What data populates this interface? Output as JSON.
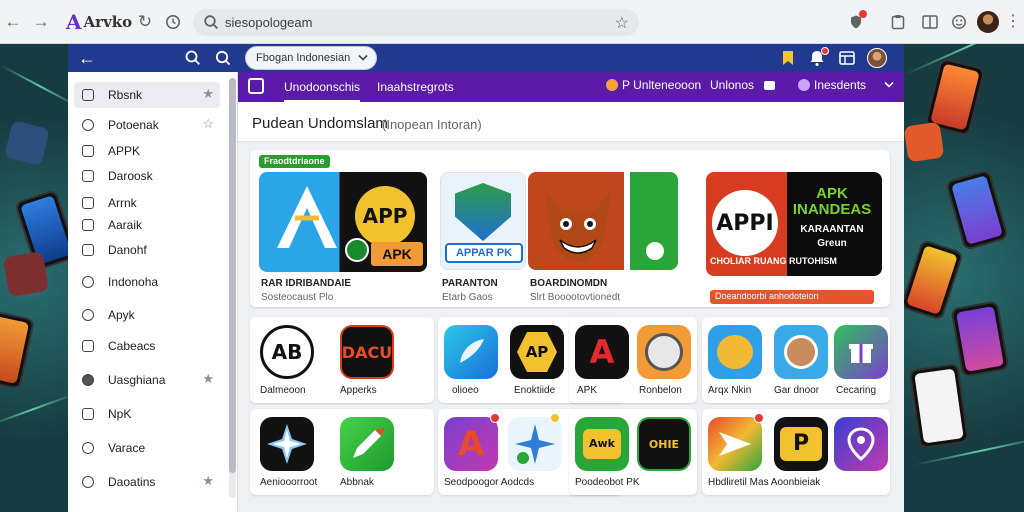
{
  "browser": {
    "brand_mark": "A",
    "brand_text": "Arvko",
    "url": "siesopologeam",
    "nav_back": "←",
    "nav_forward": "→",
    "reload": "↻",
    "menu": "⋮"
  },
  "app": {
    "country_selector": "Fbogan Indonesian",
    "tabs": [
      {
        "label": "Unodoonschis",
        "active": true
      },
      {
        "label": "Inaahstregrots",
        "active": false
      }
    ],
    "tabs_right": [
      {
        "label": "P Unlteneooon",
        "color": "#f2a33a"
      },
      {
        "label": "Unlonos",
        "color": "#ffffff"
      },
      {
        "label": "Inesdents",
        "color": "#c9a3ff"
      }
    ]
  },
  "sidebar": {
    "items": [
      {
        "label": "Rbsnk",
        "star": true,
        "active": true
      },
      {
        "label": "Potoenak",
        "star": true
      },
      {
        "label": "APPK",
        "star": false
      },
      {
        "label": "Daroosk",
        "star": false
      },
      {
        "label": "Arrnk",
        "star": false
      },
      {
        "label": "Aaraik",
        "star": false
      },
      {
        "label": "Danohf",
        "star": false
      },
      {
        "label": "Indonoha",
        "star": false
      },
      {
        "label": "Apyk",
        "star": false
      },
      {
        "label": "Cabeacs",
        "star": false
      },
      {
        "label": "Uasghiana",
        "star": true
      },
      {
        "label": "NpK",
        "star": false
      },
      {
        "label": "Varace",
        "star": false
      },
      {
        "label": "Daoatins",
        "star": true
      }
    ]
  },
  "main": {
    "title": "Pudean Undomslam",
    "subtitle": "(Inopean Intoran)",
    "featured_badge": "Fraodtdriaone",
    "featured": [
      {
        "title": "RAR IDRIBANDAIE",
        "sub": "Sosteocaust Plo",
        "art_text": "APP",
        "art_tag": "APK"
      },
      {
        "title": "PARANTON",
        "sub": "Etarb Gaos",
        "art_text": "APPAR PK"
      },
      {
        "title": "BOARDINOMDN",
        "sub": "Slrt Booootovtionedt",
        "art_text": ""
      },
      {
        "title": "CHOLIAR RUANG RUTOHISM",
        "sub": "",
        "art_text": "APPI",
        "art_big": "APK INANDEAS",
        "art_small": "KARAANTAN",
        "art_small2": "Greun",
        "bar_text": "Doeandoorbi anhodoteion"
      }
    ],
    "apps": [
      {
        "label": "Dalmeoon",
        "icon_text": "AB"
      },
      {
        "label": "Apperks",
        "icon_text": "DACU"
      },
      {
        "label": "olioeo",
        "icon_text": ""
      },
      {
        "label": "Enoktiide",
        "icon_text": "AP"
      },
      {
        "label": "APK",
        "icon_text": "A"
      },
      {
        "label": "Ronbelon",
        "icon_text": ""
      },
      {
        "label": "Arqx Nkin",
        "icon_text": ""
      },
      {
        "label": "Gar dnoor",
        "icon_text": ""
      },
      {
        "label": "Cecaring",
        "icon_text": ""
      },
      {
        "label": "Aeniooorroot",
        "icon_text": ""
      },
      {
        "label": "Abbnak",
        "icon_text": ""
      },
      {
        "label": "Seodpoogor Aodcds",
        "icon_text": "A"
      },
      {
        "label": "",
        "icon_text": ""
      },
      {
        "label": "Poodeobot PK",
        "icon_text": "Awk"
      },
      {
        "label": "",
        "icon_text": "OHIE"
      },
      {
        "label": "Hbdliretil Mas Aoonbieiak",
        "icon_text": ""
      },
      {
        "label": "",
        "icon_text": "P"
      },
      {
        "label": "",
        "icon_text": ""
      }
    ]
  },
  "colors": {
    "topbar": "#213a8f",
    "tabbar": "#5b1aa8",
    "brand": "#6a2ec8"
  }
}
